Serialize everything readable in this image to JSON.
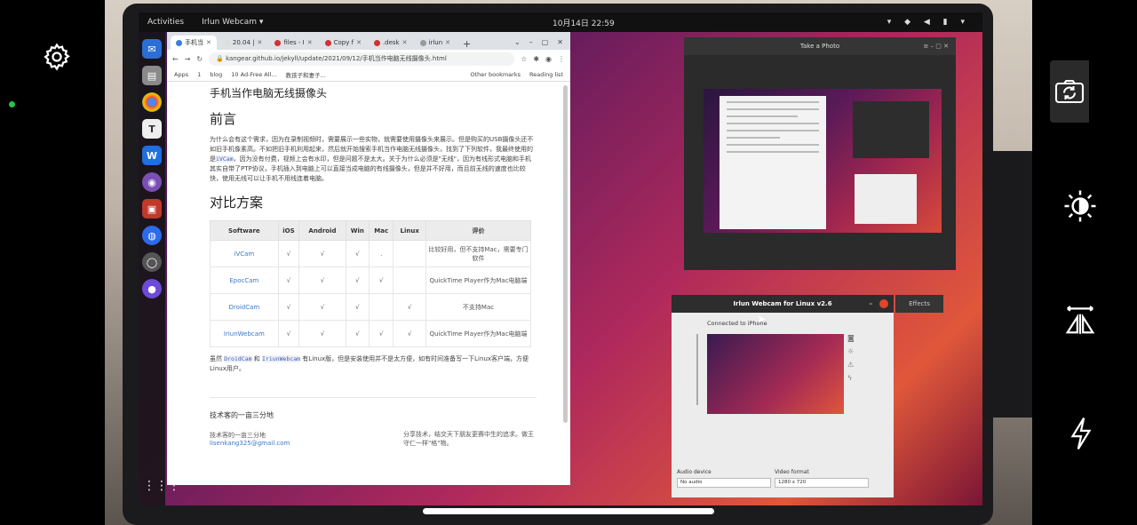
{
  "camera": {
    "settings_icon": "gear-icon",
    "switch_camera_icon": "camera-rotate-icon",
    "exposure_icon": "brightness-icon",
    "mirror_icon": "mirror-flip-icon",
    "flash_icon": "flash-icon"
  },
  "ubuntu": {
    "activities": "Activities",
    "app_menu": "Irlun Webcam ▾",
    "clock": "10月14日  22:59",
    "tray": "▾ ◆ ◀ ▮ ▾"
  },
  "browser": {
    "tabs": [
      {
        "label": "手机当"
      },
      {
        "label": "20.04 |"
      },
      {
        "label": "files - I"
      },
      {
        "label": "Copy f"
      },
      {
        "label": ".desk"
      },
      {
        "label": "irlun"
      }
    ],
    "new_tab": "+",
    "url": "kangear.github.io/jekyll/update/2021/09/12/手机当作电脑无线摄像头.html",
    "bookmarks": [
      "Apps",
      "1",
      "blog",
      "10 Ad-Free All...",
      "教孩子和妻子..."
    ],
    "other_bookmarks": "Other bookmarks",
    "reading_list": "Reading list"
  },
  "article": {
    "title": "手机当作电脑无线摄像头",
    "intro_heading": "前言",
    "intro_p1": "为什么会有这个需求，因为在录制视频时，需要展示一些实物，就需要使用摄像头来展示。但是购买的USB摄像头还不如旧手机像素高。不如把旧手机利用起来，然后就开始搜索手机当作电脑无线摄像头，找到了下列软件，我最终使用的是",
    "intro_code": "iVCam",
    "intro_p2": "，因为没有付费，视频上会有水印，但是问题不是太大。关于为什么必须是\"无线\"，因为有线形式电脑和手机其实自带了PTP协议，手机插入到电脑上可以直接当成电脑的有线摄像头，但是并不好用，而且前无线的速度也比较快，使用无线可以让手机不用线连着电脑。",
    "compare_heading": "对比方案",
    "columns": [
      "Software",
      "iOS",
      "Android",
      "Win",
      "Mac",
      "Linux",
      "评价"
    ],
    "rows": [
      [
        "iVCam",
        "√",
        "√",
        "√",
        ".",
        "",
        "比较好用，但不支持Mac，需要专门软件"
      ],
      [
        "EpocCam",
        "√",
        "√",
        "√",
        "√",
        "",
        "QuickTime Player作为Mac电脑端"
      ],
      [
        "DroidCam",
        "√",
        "√",
        "√",
        "",
        "√",
        "不支持Mac"
      ],
      [
        "IriunWebcam",
        "√",
        "√",
        "√",
        "√",
        "√",
        "QuickTime Player作为Mac电脑端"
      ]
    ],
    "note_pre": "虽然",
    "note_code1": "DroidCam",
    "note_mid": "和",
    "note_code2": "IriunWebcam",
    "note_post": "有Linux版，但是安装使用并不是太方便，如有时间准备写一下Linux客户端，方便Linux用户。",
    "footer_title": "技术客的一亩三分地",
    "footer_sub": "技术客的一亩三分地",
    "footer_email": "lisenkang325@gmail.com",
    "footer_right": "分享技术，结交天下朋友更赛中生的追求。做王守仁一样\"格\"物。"
  },
  "photo_app": {
    "title": "Take a Photo",
    "controls": "≡   –   ▢   ✕"
  },
  "irlun_app": {
    "title": "Irlun Webcam for Linux v2.6",
    "minimize": "–",
    "effects": "Effects",
    "status": "Connected to iPhone",
    "audio_label": "Audio device",
    "audio_value": "No audio",
    "video_label": "Video format",
    "video_value": "1280 x 720"
  }
}
